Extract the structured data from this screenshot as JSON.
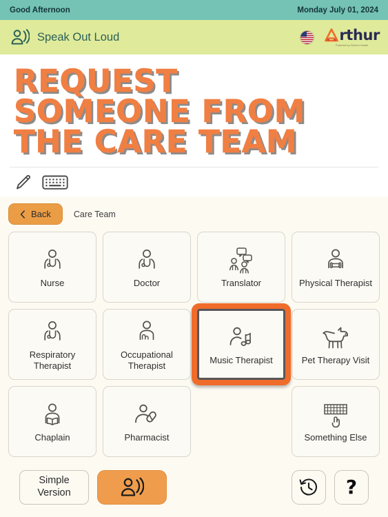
{
  "statusbar": {
    "greeting": "Good Afternoon",
    "date": "Monday July 01, 2024"
  },
  "speakbar": {
    "label": "Speak Out Loud",
    "speak_icon": "person-speaking-icon",
    "flag_icon": "us-flag-icon",
    "logo_text": "rthur",
    "logo_initial": "A",
    "logo_tagline": "Powered by Cillento Health"
  },
  "title": {
    "line1": "REQUEST",
    "line2": "SOMEONE FROM",
    "line3": "THE CARE TEAM"
  },
  "toolbar": {
    "pencil_icon": "pencil-icon",
    "keyboard_icon": "keyboard-icon"
  },
  "nav": {
    "back_label": "Back",
    "back_chevron": "chevron-left-icon",
    "breadcrumb": "Care Team"
  },
  "tiles": [
    {
      "label": "Nurse",
      "icon": "nurse-icon",
      "selected": false
    },
    {
      "label": "Doctor",
      "icon": "doctor-icon",
      "selected": false
    },
    {
      "label": "Translator",
      "icon": "translator-icon",
      "selected": false
    },
    {
      "label": "Physical Therapist",
      "icon": "physical-therapist-icon",
      "selected": false
    },
    {
      "label": "Respiratory Therapist",
      "icon": "respiratory-therapist-icon",
      "selected": false
    },
    {
      "label": "Occupational Therapist",
      "icon": "occupational-therapist-icon",
      "selected": false
    },
    {
      "label": "Music Therapist",
      "icon": "music-therapist-icon",
      "selected": true
    },
    {
      "label": "Pet Therapy Visit",
      "icon": "dog-icon",
      "selected": false
    },
    {
      "label": "Chaplain",
      "icon": "chaplain-icon",
      "selected": false
    },
    {
      "label": "Pharmacist",
      "icon": "pharmacist-icon",
      "selected": false
    },
    {
      "label": "",
      "icon": "",
      "selected": false
    },
    {
      "label": "Something Else",
      "icon": "keyboard-hand-icon",
      "selected": false
    }
  ],
  "bottombar": {
    "simple_line1": "Simple",
    "simple_line2": "Version",
    "speak_icon": "person-speaking-icon",
    "history_icon": "history-clock-icon",
    "help_icon": "question-mark-icon"
  },
  "colors": {
    "statusbar_bg": "#74c3b4",
    "speakbar_bg": "#dfeb9a",
    "panel_bg": "#fdfaf2",
    "accent_orange": "#ef6c2a",
    "button_orange": "#eb9d46",
    "title_orange": "#f07f43"
  }
}
